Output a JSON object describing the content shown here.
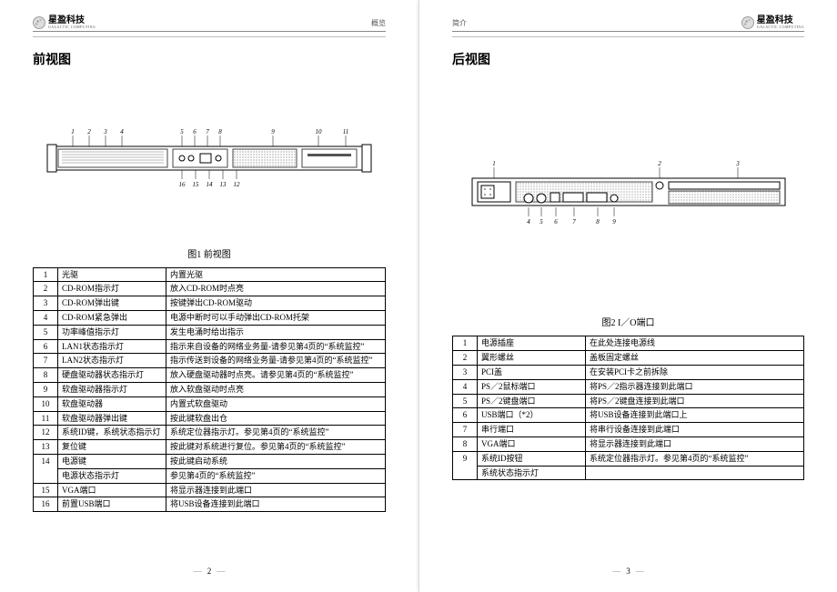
{
  "brand": {
    "cn": "星盈科技",
    "en": "GALACTIC COMPUTING"
  },
  "leftPage": {
    "headerLabel": "概览",
    "title": "前视图",
    "figCaption": "图1  前视图",
    "topCallouts": [
      "1",
      "2",
      "3",
      "4",
      "5",
      "6",
      "7",
      "8",
      "9",
      "10",
      "11"
    ],
    "bottomCallouts": [
      "16",
      "15",
      "14",
      "13",
      "12"
    ],
    "table": [
      {
        "num": "1",
        "name": "光驱",
        "desc": "内置光驱"
      },
      {
        "num": "2",
        "name": "CD-ROM指示灯",
        "desc": "放入CD-ROM时点亮"
      },
      {
        "num": "3",
        "name": "CD-ROM弹出键",
        "desc": "按键弹出CD-ROM驱动"
      },
      {
        "num": "4",
        "name": "CD-ROM紧急弹出",
        "desc": "电源中断时可以手动弹出CD-ROM托架"
      },
      {
        "num": "5",
        "name": "功率峰值指示灯",
        "desc": "发生电涌时给出指示"
      },
      {
        "num": "6",
        "name": "LAN1状态指示灯",
        "desc": "指示来自设备的网络业务量-请参见第4页的“系统监控”"
      },
      {
        "num": "7",
        "name": "LAN2状态指示灯",
        "desc": "指示传送到设备的网络业务量-请参见第4页的“系统监控”"
      },
      {
        "num": "8",
        "name": "硬盘驱动器状态指示灯",
        "desc": "放入硬盘驱动器时点亮。请参见第4页的“系统监控”"
      },
      {
        "num": "9",
        "name": "软盘驱动器指示灯",
        "desc": "放入软盘驱动时点亮"
      },
      {
        "num": "10",
        "name": "软盘驱动器",
        "desc": "内置式软盘驱动"
      },
      {
        "num": "11",
        "name": "软盘驱动器弹出键",
        "desc": "按此键软盘出仓"
      },
      {
        "num": "12",
        "name": "系统ID键，系统状态指示灯",
        "desc": "系统定位器指示灯。参见第4页的“系统监控”"
      },
      {
        "num": "13",
        "name": "复位键",
        "desc": "按此键对系统进行复位。参见第4页的“系统监控”"
      },
      {
        "num": "14",
        "name": "电源键\n电源状态指示灯",
        "desc": "按此键启动系统\n参见第4页的“系统监控”"
      },
      {
        "num": "15",
        "name": "VGA端口",
        "desc": "将显示器连接到此端口"
      },
      {
        "num": "16",
        "name": "前置USB端口",
        "desc": "将USB设备连接到此端口"
      }
    ],
    "pageNum": "2"
  },
  "rightPage": {
    "headerLabel": "简介",
    "title": "后视图",
    "figCaption": "图2  I／O端口",
    "topCallouts": [
      "1",
      "2",
      "3"
    ],
    "bottomCallouts": [
      "4",
      "5",
      "6",
      "7",
      "8",
      "9"
    ],
    "table": [
      {
        "num": "1",
        "name": "电源插座",
        "desc": "在此处连接电源线"
      },
      {
        "num": "2",
        "name": "翼形螺丝",
        "desc": "盖板固定螺丝"
      },
      {
        "num": "3",
        "name": "PCI盖",
        "desc": "在安装PCI卡之前拆除"
      },
      {
        "num": "4",
        "name": "PS／2鼠标端口",
        "desc": "将PS／2指示器连接到此端口"
      },
      {
        "num": "5",
        "name": "PS／2键盘端口",
        "desc": "将PS／2键盘连接到此端口"
      },
      {
        "num": "6",
        "name": "USB端口（*2）",
        "desc": "将USB设备连接到此端口上"
      },
      {
        "num": "7",
        "name": "串行端口",
        "desc": "将串行设备连接到此端口"
      },
      {
        "num": "8",
        "name": "VGA端口",
        "desc": "将显示器连接到此端口"
      },
      {
        "num": "9",
        "name": "系统ID按钮\n系统状态指示灯",
        "desc": "系统定位器指示灯。参见第4页的“系统监控”"
      }
    ],
    "pageNum": "3"
  }
}
